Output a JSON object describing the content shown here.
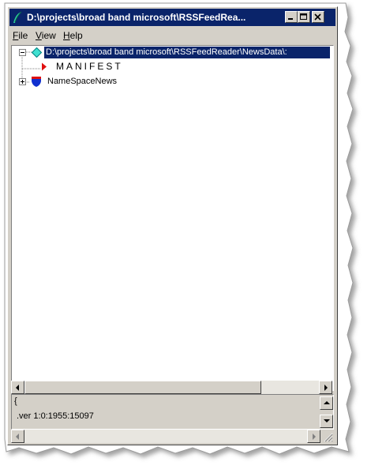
{
  "window": {
    "title": "D:\\projects\\broad band microsoft\\RSSFeedRea...",
    "controls": [
      "minimize-icon",
      "maximize-icon",
      "close-icon"
    ]
  },
  "menu": [
    {
      "label": "File",
      "mnemonic": "F",
      "rest": "ile"
    },
    {
      "label": "View",
      "mnemonic": "V",
      "rest": "iew"
    },
    {
      "label": "Help",
      "mnemonic": "H",
      "rest": "elp"
    }
  ],
  "tree": {
    "root": {
      "label": "D:\\projects\\broad band microsoft\\RSSFeedReader\\NewsData\\:",
      "icon": "diamond-icon",
      "expanded": true
    },
    "children": [
      {
        "label": "MANIFEST",
        "icon": "red-arrow-icon",
        "expandable": false
      },
      {
        "label": "NameSpaceNews",
        "icon": "shield-icon",
        "expandable": true
      }
    ]
  },
  "status": {
    "line1": "{",
    "line2": ".ver 1:0:1955:15097"
  },
  "colors": {
    "titlebar": "#0a246a",
    "selection": "#0a246a",
    "window_face": "#d4d0c8"
  }
}
